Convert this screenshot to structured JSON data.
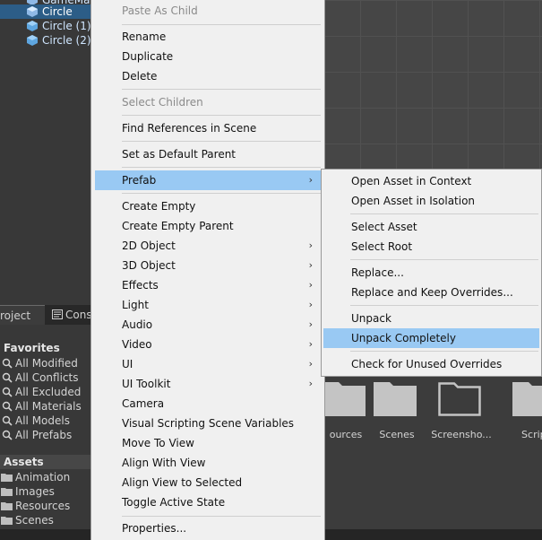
{
  "hierarchy": {
    "items": [
      {
        "label": "GameMa..."
      },
      {
        "label": "Circle"
      },
      {
        "label": "Circle (1)"
      },
      {
        "label": "Circle (2)"
      }
    ]
  },
  "project": {
    "tabs": [
      {
        "label": "roject"
      },
      {
        "label": "Cons"
      }
    ],
    "favorites_title": "Favorites",
    "favorites": [
      {
        "label": "All Modified"
      },
      {
        "label": "All Conflicts"
      },
      {
        "label": "All Excluded"
      },
      {
        "label": "All Materials"
      },
      {
        "label": "All Models"
      },
      {
        "label": "All Prefabs"
      }
    ],
    "assets_title": "Assets",
    "assets": [
      {
        "label": "Animation"
      },
      {
        "label": "Images"
      },
      {
        "label": "Resources"
      },
      {
        "label": "Scenes"
      }
    ],
    "grid": [
      {
        "label": "ources"
      },
      {
        "label": "Scenes"
      },
      {
        "label": "Screensho..."
      },
      {
        "label": "Script"
      }
    ]
  },
  "menu": {
    "paste_as_child": "Paste As Child",
    "rename": "Rename",
    "duplicate": "Duplicate",
    "delete": "Delete",
    "select_children": "Select Children",
    "find_references": "Find References in Scene",
    "set_default_parent": "Set as Default Parent",
    "prefab": "Prefab",
    "create_empty": "Create Empty",
    "create_empty_parent": "Create Empty Parent",
    "object_2d": "2D Object",
    "object_3d": "3D Object",
    "effects": "Effects",
    "light": "Light",
    "audio": "Audio",
    "video": "Video",
    "ui": "UI",
    "ui_toolkit": "UI Toolkit",
    "camera": "Camera",
    "visual_scripting": "Visual Scripting Scene Variables",
    "move_to_view": "Move To View",
    "align_with_view": "Align With View",
    "align_view_to_selected": "Align View to Selected",
    "toggle_active": "Toggle Active State",
    "properties": "Properties..."
  },
  "submenu": {
    "open_in_context": "Open Asset in Context",
    "open_in_isolation": "Open Asset in Isolation",
    "select_asset": "Select Asset",
    "select_root": "Select Root",
    "replace": "Replace...",
    "replace_keep": "Replace and Keep Overrides...",
    "unpack": "Unpack",
    "unpack_completely": "Unpack Completely",
    "check_unused": "Check for Unused Overrides"
  },
  "colors": {
    "highlight": "#99c9f3",
    "hierarchy_selected": "#2c5d87",
    "menu_bg": "#f0f0f0"
  },
  "icons": {
    "submenu_arrow": "chevron-right-icon",
    "hierarchy_object": "cube-icon",
    "favorite": "search-icon",
    "asset": "folder-icon"
  }
}
